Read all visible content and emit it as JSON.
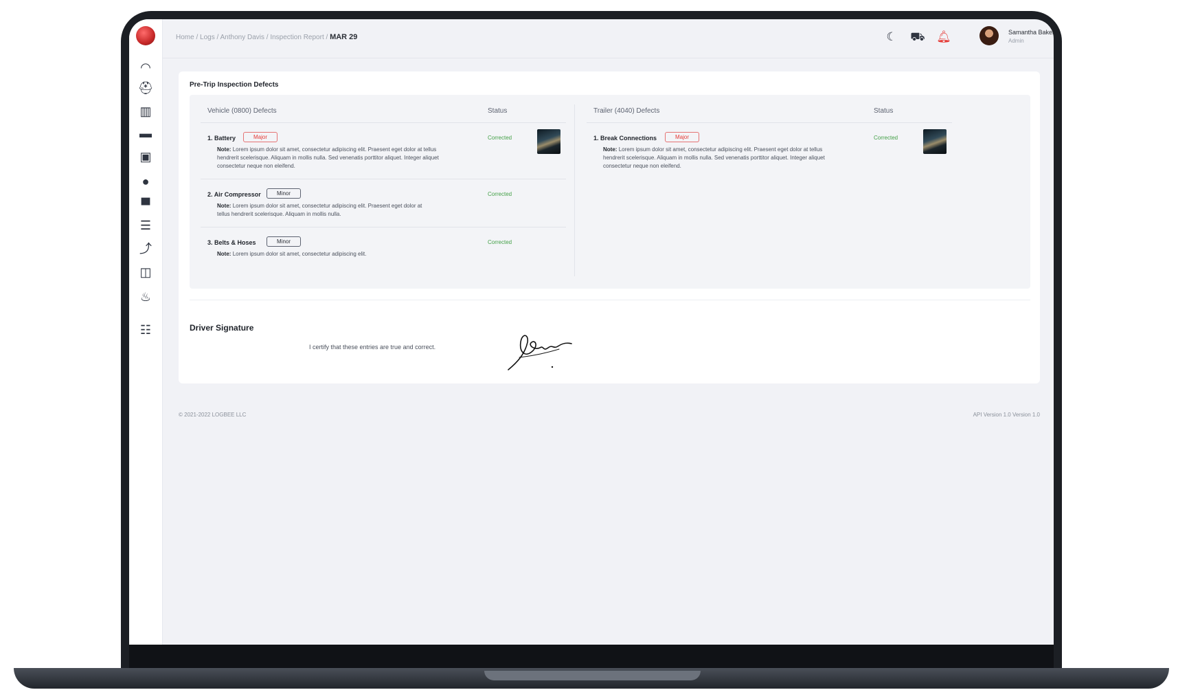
{
  "header": {
    "breadcrumb": [
      "Home",
      "Logs",
      "Anthony Davis",
      "Inspection Report"
    ],
    "breadcrumb_current": "MAR 29",
    "user": {
      "name": "Samantha Baker",
      "role": "Admin"
    }
  },
  "card": {
    "title": "Pre-Trip Inspection Defects",
    "vehicle": {
      "heading": "Vehicle (0800) Defects",
      "status_heading": "Status",
      "items": [
        {
          "num": "1.",
          "title": "Battery",
          "severity": "Major",
          "note_label": "Note:",
          "note": "Lorem ipsum dolor sit amet, consectetur adipiscing elit. Praesent eget dolor at tellus hendrerit scelerisque. Aliquam in mollis nulla. Sed venenatis porttitor aliquet. Integer aliquet consectetur neque non eleifend.",
          "status": "Corrected"
        },
        {
          "num": "2.",
          "title": "Air Compressor",
          "severity": "Minor",
          "note_label": "Note:",
          "note": "Lorem ipsum dolor sit amet, consectetur adipiscing elit. Praesent eget dolor at tellus hendrerit scelerisque. Aliquam in mollis nulla.",
          "status": "Corrected"
        },
        {
          "num": "3.",
          "title": "Belts & Hoses",
          "severity": "Minor",
          "note_label": "Note:",
          "note": "Lorem ipsum dolor sit amet, consectetur adipiscing elit.",
          "status": "Corrected"
        }
      ]
    },
    "trailer": {
      "heading": "Trailer (4040) Defects",
      "status_heading": "Status",
      "items": [
        {
          "num": "1.",
          "title": "Break Connections",
          "severity": "Major",
          "note_label": "Note:",
          "note": "Lorem ipsum dolor sit amet, consectetur adipiscing elit. Praesent eget dolor at tellus hendrerit scelerisque. Aliquam in mollis nulla. Sed venenatis porttitor aliquet. Integer aliquet consectetur neque non eleifend.",
          "status": "Corrected"
        }
      ]
    },
    "signature": {
      "title": "Driver Signature",
      "certification": "I certify that these entries are true and correct."
    }
  },
  "footer": {
    "copyright": "© 2021-2022 LOGBEE LLC",
    "versions": "API Version 1.0 Version 1.0"
  },
  "colors": {
    "major": "#e53935",
    "corrected": "#43a047",
    "background": "#f1f2f6"
  },
  "icons": [
    "moon-icon",
    "truck-icon",
    "bell-icon",
    "dashboard-icon",
    "drivers-icon",
    "reports-icon",
    "vehicles-icon",
    "bus-icon",
    "user-icon",
    "trailer-icon",
    "logs-icon",
    "fuel-icon",
    "stats-icon",
    "ifta-icon",
    "settings-icon"
  ]
}
